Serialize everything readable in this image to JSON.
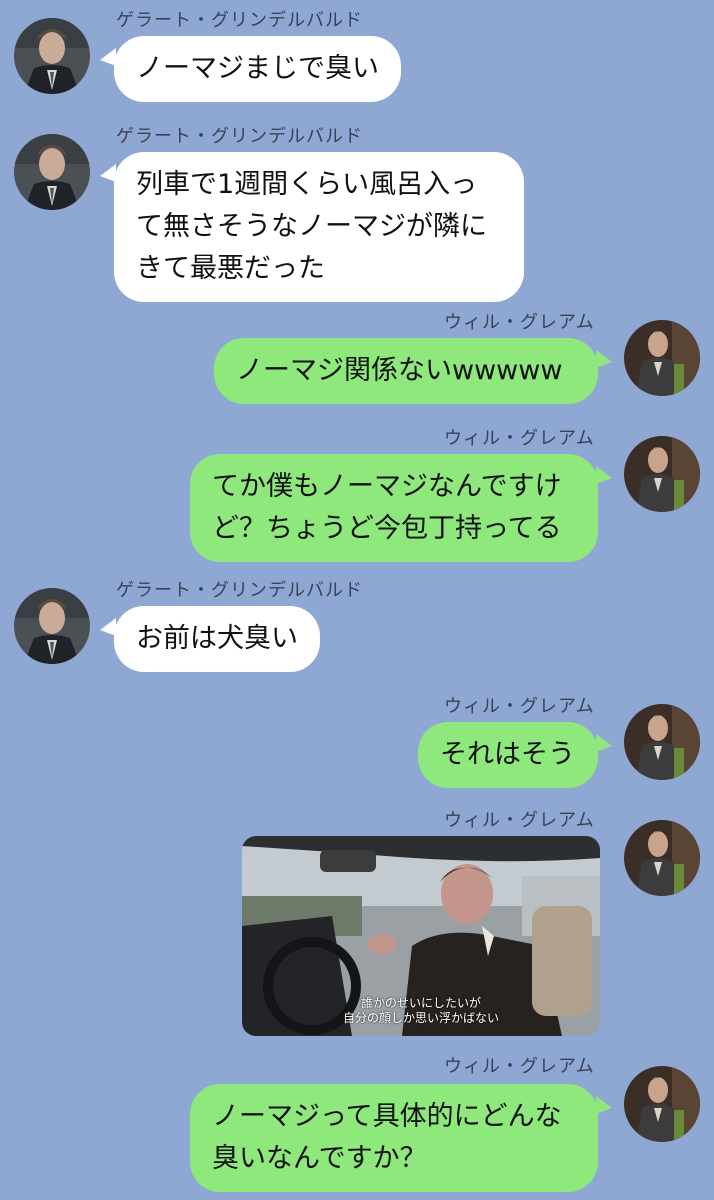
{
  "chat": {
    "messages": [
      {
        "sender": "ゲラート・グリンデルバルド",
        "side": "left",
        "text": "ノーマジまじで臭い"
      },
      {
        "sender": "ゲラート・グリンデルバルド",
        "side": "left",
        "lines": [
          "列車で1週間くらい風呂入っ",
          "て無さそうなノーマジが隣に",
          "きて最悪だった"
        ]
      },
      {
        "sender": "ウィル・グレアム",
        "side": "right",
        "text": "ノーマジ関係ないwwwww"
      },
      {
        "sender": "ウィル・グレアム",
        "side": "right",
        "lines": [
          "てか僕もノーマジなんですけ",
          "ど？ちょうど今包丁持ってる"
        ]
      },
      {
        "sender": "ゲラート・グリンデルバルド",
        "side": "left",
        "text": "お前は犬臭い"
      },
      {
        "sender": "ウィル・グレアム",
        "side": "right",
        "text": "それはそう"
      },
      {
        "sender": "ウィル・グレアム",
        "side": "right",
        "type": "image",
        "subtitle": [
          "誰かのせいにしたいが",
          "自分の顔しか思い浮かばない"
        ]
      },
      {
        "sender": "ウィル・グレアム",
        "side": "right",
        "lines": [
          "ノーマジって具体的にどんな",
          "臭いなんですか？"
        ]
      }
    ]
  },
  "colors": {
    "background": "#8fa7d3",
    "bubble_left": "#ffffff",
    "bubble_right": "#8ee87c"
  },
  "icons": {
    "left_avatar": "avatar-grindelwald",
    "right_avatar": "avatar-will-graham"
  }
}
